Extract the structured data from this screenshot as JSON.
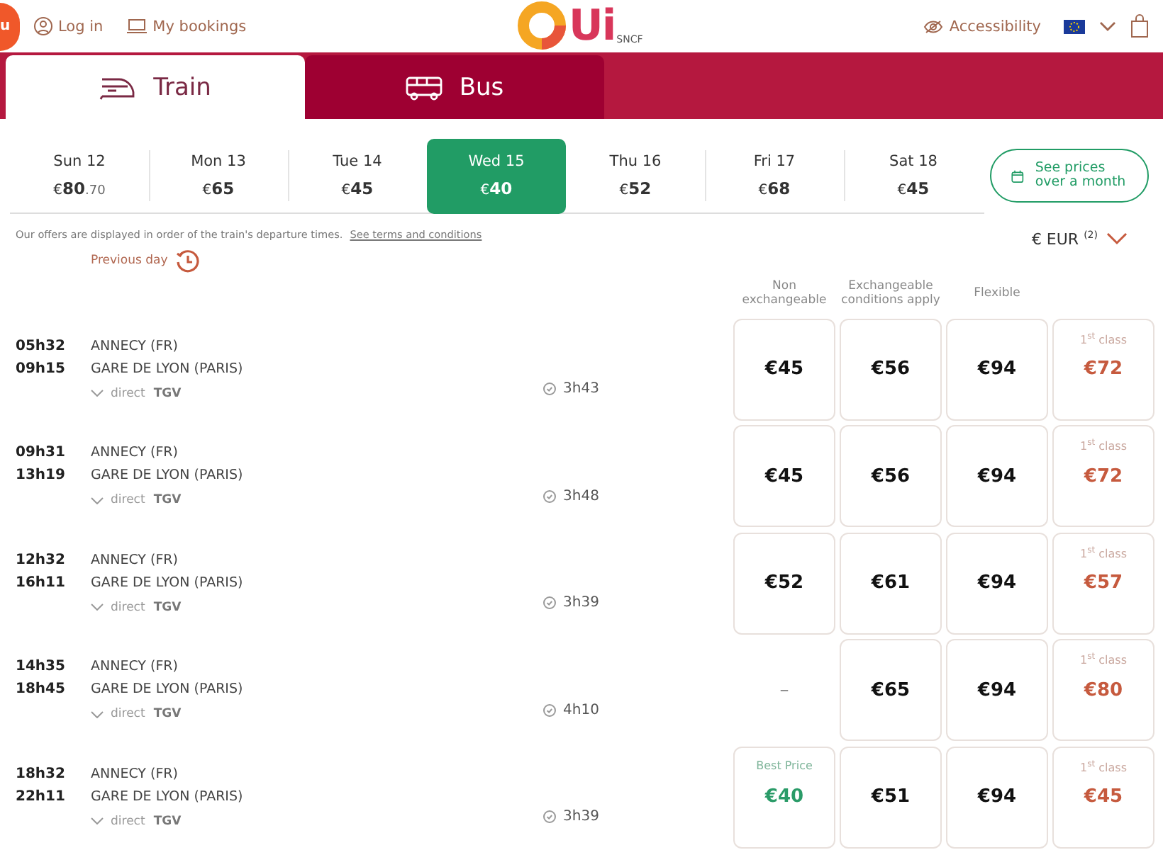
{
  "header": {
    "corner_label": "u",
    "login": "Log in",
    "bookings": "My bookings",
    "logo": "Ui",
    "logo_suffix": "SNCF",
    "accessibility": "Accessibility"
  },
  "mode_tabs": [
    {
      "label": "Train",
      "kind": "train",
      "selected": true
    },
    {
      "label": "Bus",
      "kind": "bus",
      "selected": false
    }
  ],
  "days": [
    {
      "day": "Sun 12",
      "price": "€**80**.70",
      "selected": false
    },
    {
      "day": "Mon 13",
      "price": "€**65**",
      "selected": false
    },
    {
      "day": "Tue 14",
      "price": "€**45**",
      "selected": false
    },
    {
      "day": "Wed 15",
      "price": "€**40**",
      "selected": true
    },
    {
      "day": "Thu 16",
      "price": "€**52**",
      "selected": false
    },
    {
      "day": "Fri 17",
      "price": "€**68**",
      "selected": false
    },
    {
      "day": "Sat 18",
      "price": "€**45**",
      "selected": false
    }
  ],
  "month_button": "See prices over a month",
  "notice": "Our offers are displayed in order of the train's departure times.",
  "terms_link": "See terms and conditions",
  "currency": "€ EUR $^{(2)}$",
  "previous_day": "Previous day",
  "fare_columns": [
    "Non exchangeable",
    "Exchangeable conditions apply",
    "Flexible"
  ],
  "journeys": [
    {
      "depart": "05h32",
      "arrive": "09h15",
      "from": "ANNECY (FR)",
      "to": "GARE DE LYON (PARIS)",
      "stops": "direct",
      "train": "TGV",
      "duration": "3h43",
      "fares": [
        {
          "kind": "standard",
          "price": "€45"
        },
        {
          "kind": "standard",
          "price": "€56"
        },
        {
          "kind": "standard",
          "price": "€94"
        },
        {
          "kind": "first",
          "label": "1$^{st}$ class",
          "price": "€72"
        }
      ]
    },
    {
      "depart": "09h31",
      "arrive": "13h19",
      "from": "ANNECY (FR)",
      "to": "GARE DE LYON (PARIS)",
      "stops": "direct",
      "train": "TGV",
      "duration": "3h48",
      "fares": [
        {
          "kind": "standard",
          "price": "€45"
        },
        {
          "kind": "standard",
          "price": "€56"
        },
        {
          "kind": "standard",
          "price": "€94"
        },
        {
          "kind": "first",
          "label": "1$^{st}$ class",
          "price": "€72"
        }
      ]
    },
    {
      "depart": "12h32",
      "arrive": "16h11",
      "from": "ANNECY (FR)",
      "to": "GARE DE LYON (PARIS)",
      "stops": "direct",
      "train": "TGV",
      "duration": "3h39",
      "fares": [
        {
          "kind": "standard",
          "price": "€52"
        },
        {
          "kind": "standard",
          "price": "€61"
        },
        {
          "kind": "standard",
          "price": "€94"
        },
        {
          "kind": "first",
          "label": "1$^{st}$ class",
          "price": "€57"
        }
      ]
    },
    {
      "depart": "14h35",
      "arrive": "18h45",
      "from": "ANNECY (FR)",
      "to": "GARE DE LYON (PARIS)",
      "stops": "direct",
      "train": "TGV",
      "duration": "4h10",
      "fares": [
        {
          "kind": "empty",
          "price": "–"
        },
        {
          "kind": "standard",
          "price": "€65"
        },
        {
          "kind": "standard",
          "price": "€94"
        },
        {
          "kind": "first",
          "label": "1$^{st}$ class",
          "price": "€80"
        }
      ]
    },
    {
      "depart": "18h32",
      "arrive": "22h11",
      "from": "ANNECY (FR)",
      "to": "GARE DE LYON (PARIS)",
      "stops": "direct",
      "train": "TGV",
      "duration": "3h39",
      "fares": [
        {
          "kind": "best",
          "label": "Best Price",
          "price": "€40"
        },
        {
          "kind": "standard",
          "price": "€51"
        },
        {
          "kind": "standard",
          "price": "€94"
        },
        {
          "kind": "first",
          "label": "1$^{st}$ class",
          "price": "€45"
        }
      ]
    }
  ]
}
